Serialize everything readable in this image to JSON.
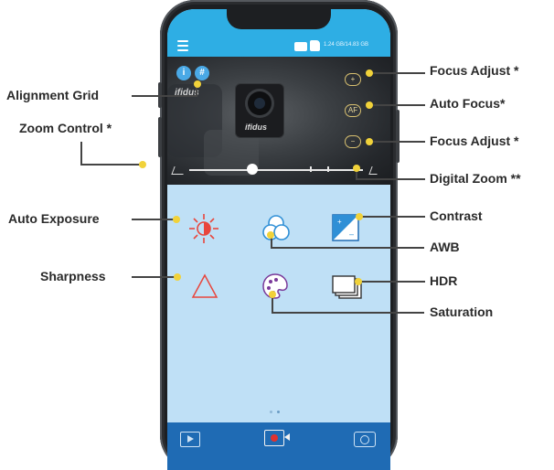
{
  "app": {
    "status_text": "1.24 GB/14.83 GB",
    "brand_text": "ifidus",
    "info_glyph": "i",
    "grid_glyph": "#",
    "focus_plus": "+",
    "focus_af": "AF",
    "focus_minus": "−",
    "icons": [
      "menu-icon",
      "battery-icon",
      "sd-card-icon",
      "info-icon",
      "grid-icon",
      "zoom-out-icon",
      "zoom-in-icon",
      "exposure-icon",
      "awb-icon",
      "contrast-icon",
      "sharpness-icon",
      "saturation-icon",
      "hdr-icon",
      "play-icon",
      "record-icon",
      "camera-icon"
    ]
  },
  "callouts": {
    "focus_adjust_top": "Focus Adjust *",
    "auto_focus": "Auto Focus*",
    "focus_adjust_bottom": "Focus Adjust *",
    "digital_zoom": "Digital Zoom **",
    "alignment_grid": "Alignment Grid",
    "zoom_control": "Zoom Control *",
    "auto_exposure": "Auto Exposure",
    "contrast": "Contrast",
    "awb": "AWB",
    "sharpness": "Sharpness",
    "hdr": "HDR",
    "saturation": "Saturation"
  },
  "colors": {
    "top_bar": "#2eaee4",
    "bottom_bar": "#1f6bb4",
    "controls_bg": "#bfe0f6",
    "callout_dot": "#f1d23a",
    "record_red": "#e0322e",
    "exposure_red": "#e8463d"
  }
}
